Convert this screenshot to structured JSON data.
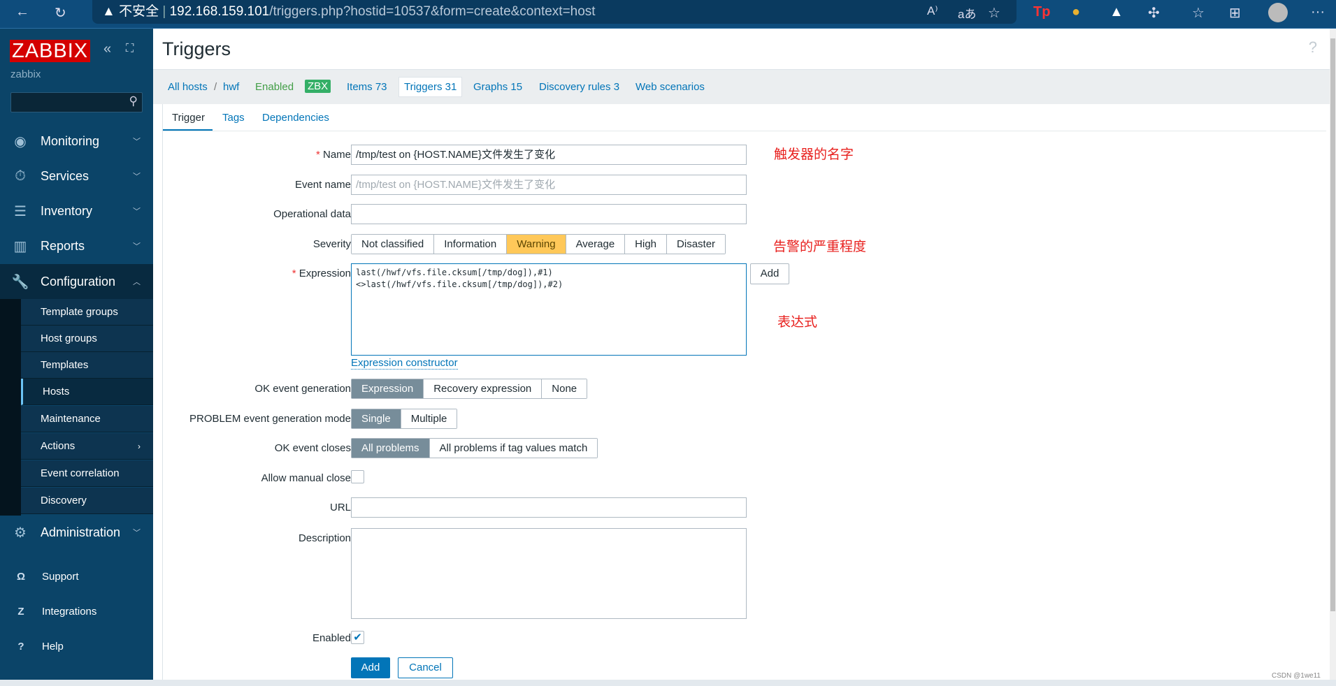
{
  "browser": {
    "security": "不安全",
    "url_host": "192.168.159.101",
    "url_path": "/triggers.php?hostid=10537&form=create&context=host"
  },
  "sidebar": {
    "logo": "ZABBIX",
    "user": "zabbix",
    "search_placeholder": "",
    "main": [
      {
        "label": "Monitoring",
        "icon": "eye-icon"
      },
      {
        "label": "Services",
        "icon": "stopwatch-icon"
      },
      {
        "label": "Inventory",
        "icon": "list-icon"
      },
      {
        "label": "Reports",
        "icon": "bar-chart-icon"
      },
      {
        "label": "Configuration",
        "icon": "wrench-icon"
      }
    ],
    "config_items": [
      "Template groups",
      "Host groups",
      "Templates",
      "Hosts",
      "Maintenance",
      "Actions",
      "Event correlation",
      "Discovery"
    ],
    "active_item": "Hosts",
    "administration": "Administration",
    "bottom": [
      {
        "label": "Support",
        "icon": "headset-icon"
      },
      {
        "label": "Integrations",
        "icon": "z-icon"
      },
      {
        "label": "Help",
        "icon": "help-icon"
      }
    ]
  },
  "page": {
    "title": "Triggers",
    "help": "?"
  },
  "host_nav": {
    "all_hosts": "All hosts",
    "sep": "/",
    "host": "hwf",
    "status": "Enabled",
    "zbx": "ZBX",
    "items": "Items 73",
    "triggers": "Triggers 31",
    "graphs": "Graphs 15",
    "discovery": "Discovery rules 3",
    "web": "Web scenarios"
  },
  "tabs": [
    "Trigger",
    "Tags",
    "Dependencies"
  ],
  "form": {
    "name_label": "Name",
    "name_value": "/tmp/test on {HOST.NAME}文件发生了变化",
    "event_name_label": "Event name",
    "event_name_placeholder": "/tmp/test on {HOST.NAME}文件发生了变化",
    "opdata_label": "Operational data",
    "severity_label": "Severity",
    "severities": [
      "Not classified",
      "Information",
      "Warning",
      "Average",
      "High",
      "Disaster"
    ],
    "severity_selected": "Warning",
    "expression_label": "Expression",
    "expression_value": "last(/hwf/vfs.file.cksum[/tmp/dog]),#1)\n<>last(/hwf/vfs.file.cksum[/tmp/dog]),#2)",
    "expression_add": "Add",
    "expression_constructor": "Expression constructor",
    "ok_gen_label": "OK event generation",
    "ok_gen_options": [
      "Expression",
      "Recovery expression",
      "None"
    ],
    "problem_mode_label": "PROBLEM event generation mode",
    "problem_mode_options": [
      "Single",
      "Multiple"
    ],
    "ok_closes_label": "OK event closes",
    "ok_closes_options": [
      "All problems",
      "All problems if tag values match"
    ],
    "manual_close_label": "Allow manual close",
    "manual_close": false,
    "url_label": "URL",
    "description_label": "Description",
    "enabled_label": "Enabled",
    "enabled": true,
    "add": "Add",
    "cancel": "Cancel"
  },
  "annotations": {
    "name": "触发器的名字",
    "severity": "告警的严重程度",
    "expression": "表达式"
  },
  "watermark": "CSDN @1we11",
  "colors": {
    "sidebar": "#0b4468",
    "accent": "#0275b8",
    "warning": "#ffc859",
    "selected_segment": "#778d9a",
    "logo": "#d40000",
    "annotation": "#e8201e"
  }
}
